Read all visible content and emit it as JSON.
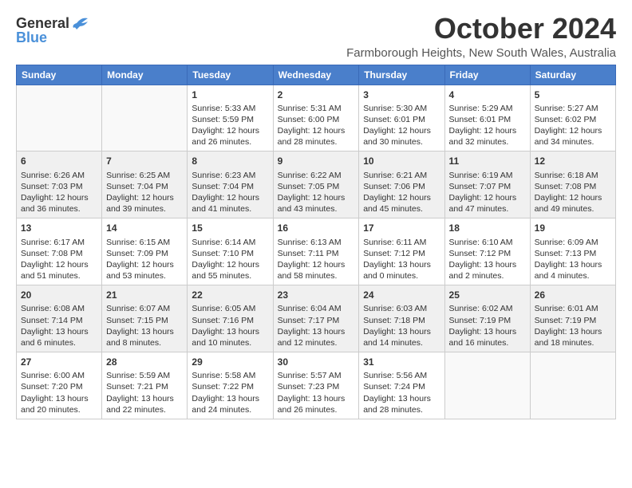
{
  "logo": {
    "general": "General",
    "blue": "Blue"
  },
  "title": "October 2024",
  "subtitle": "Farmborough Heights, New South Wales, Australia",
  "days_of_week": [
    "Sunday",
    "Monday",
    "Tuesday",
    "Wednesday",
    "Thursday",
    "Friday",
    "Saturday"
  ],
  "weeks": [
    {
      "shaded": false,
      "days": [
        {
          "num": "",
          "info": ""
        },
        {
          "num": "",
          "info": ""
        },
        {
          "num": "1",
          "info": "Sunrise: 5:33 AM\nSunset: 5:59 PM\nDaylight: 12 hours and 26 minutes."
        },
        {
          "num": "2",
          "info": "Sunrise: 5:31 AM\nSunset: 6:00 PM\nDaylight: 12 hours and 28 minutes."
        },
        {
          "num": "3",
          "info": "Sunrise: 5:30 AM\nSunset: 6:01 PM\nDaylight: 12 hours and 30 minutes."
        },
        {
          "num": "4",
          "info": "Sunrise: 5:29 AM\nSunset: 6:01 PM\nDaylight: 12 hours and 32 minutes."
        },
        {
          "num": "5",
          "info": "Sunrise: 5:27 AM\nSunset: 6:02 PM\nDaylight: 12 hours and 34 minutes."
        }
      ]
    },
    {
      "shaded": true,
      "days": [
        {
          "num": "6",
          "info": "Sunrise: 6:26 AM\nSunset: 7:03 PM\nDaylight: 12 hours and 36 minutes."
        },
        {
          "num": "7",
          "info": "Sunrise: 6:25 AM\nSunset: 7:04 PM\nDaylight: 12 hours and 39 minutes."
        },
        {
          "num": "8",
          "info": "Sunrise: 6:23 AM\nSunset: 7:04 PM\nDaylight: 12 hours and 41 minutes."
        },
        {
          "num": "9",
          "info": "Sunrise: 6:22 AM\nSunset: 7:05 PM\nDaylight: 12 hours and 43 minutes."
        },
        {
          "num": "10",
          "info": "Sunrise: 6:21 AM\nSunset: 7:06 PM\nDaylight: 12 hours and 45 minutes."
        },
        {
          "num": "11",
          "info": "Sunrise: 6:19 AM\nSunset: 7:07 PM\nDaylight: 12 hours and 47 minutes."
        },
        {
          "num": "12",
          "info": "Sunrise: 6:18 AM\nSunset: 7:08 PM\nDaylight: 12 hours and 49 minutes."
        }
      ]
    },
    {
      "shaded": false,
      "days": [
        {
          "num": "13",
          "info": "Sunrise: 6:17 AM\nSunset: 7:08 PM\nDaylight: 12 hours and 51 minutes."
        },
        {
          "num": "14",
          "info": "Sunrise: 6:15 AM\nSunset: 7:09 PM\nDaylight: 12 hours and 53 minutes."
        },
        {
          "num": "15",
          "info": "Sunrise: 6:14 AM\nSunset: 7:10 PM\nDaylight: 12 hours and 55 minutes."
        },
        {
          "num": "16",
          "info": "Sunrise: 6:13 AM\nSunset: 7:11 PM\nDaylight: 12 hours and 58 minutes."
        },
        {
          "num": "17",
          "info": "Sunrise: 6:11 AM\nSunset: 7:12 PM\nDaylight: 13 hours and 0 minutes."
        },
        {
          "num": "18",
          "info": "Sunrise: 6:10 AM\nSunset: 7:12 PM\nDaylight: 13 hours and 2 minutes."
        },
        {
          "num": "19",
          "info": "Sunrise: 6:09 AM\nSunset: 7:13 PM\nDaylight: 13 hours and 4 minutes."
        }
      ]
    },
    {
      "shaded": true,
      "days": [
        {
          "num": "20",
          "info": "Sunrise: 6:08 AM\nSunset: 7:14 PM\nDaylight: 13 hours and 6 minutes."
        },
        {
          "num": "21",
          "info": "Sunrise: 6:07 AM\nSunset: 7:15 PM\nDaylight: 13 hours and 8 minutes."
        },
        {
          "num": "22",
          "info": "Sunrise: 6:05 AM\nSunset: 7:16 PM\nDaylight: 13 hours and 10 minutes."
        },
        {
          "num": "23",
          "info": "Sunrise: 6:04 AM\nSunset: 7:17 PM\nDaylight: 13 hours and 12 minutes."
        },
        {
          "num": "24",
          "info": "Sunrise: 6:03 AM\nSunset: 7:18 PM\nDaylight: 13 hours and 14 minutes."
        },
        {
          "num": "25",
          "info": "Sunrise: 6:02 AM\nSunset: 7:19 PM\nDaylight: 13 hours and 16 minutes."
        },
        {
          "num": "26",
          "info": "Sunrise: 6:01 AM\nSunset: 7:19 PM\nDaylight: 13 hours and 18 minutes."
        }
      ]
    },
    {
      "shaded": false,
      "days": [
        {
          "num": "27",
          "info": "Sunrise: 6:00 AM\nSunset: 7:20 PM\nDaylight: 13 hours and 20 minutes."
        },
        {
          "num": "28",
          "info": "Sunrise: 5:59 AM\nSunset: 7:21 PM\nDaylight: 13 hours and 22 minutes."
        },
        {
          "num": "29",
          "info": "Sunrise: 5:58 AM\nSunset: 7:22 PM\nDaylight: 13 hours and 24 minutes."
        },
        {
          "num": "30",
          "info": "Sunrise: 5:57 AM\nSunset: 7:23 PM\nDaylight: 13 hours and 26 minutes."
        },
        {
          "num": "31",
          "info": "Sunrise: 5:56 AM\nSunset: 7:24 PM\nDaylight: 13 hours and 28 minutes."
        },
        {
          "num": "",
          "info": ""
        },
        {
          "num": "",
          "info": ""
        }
      ]
    }
  ]
}
